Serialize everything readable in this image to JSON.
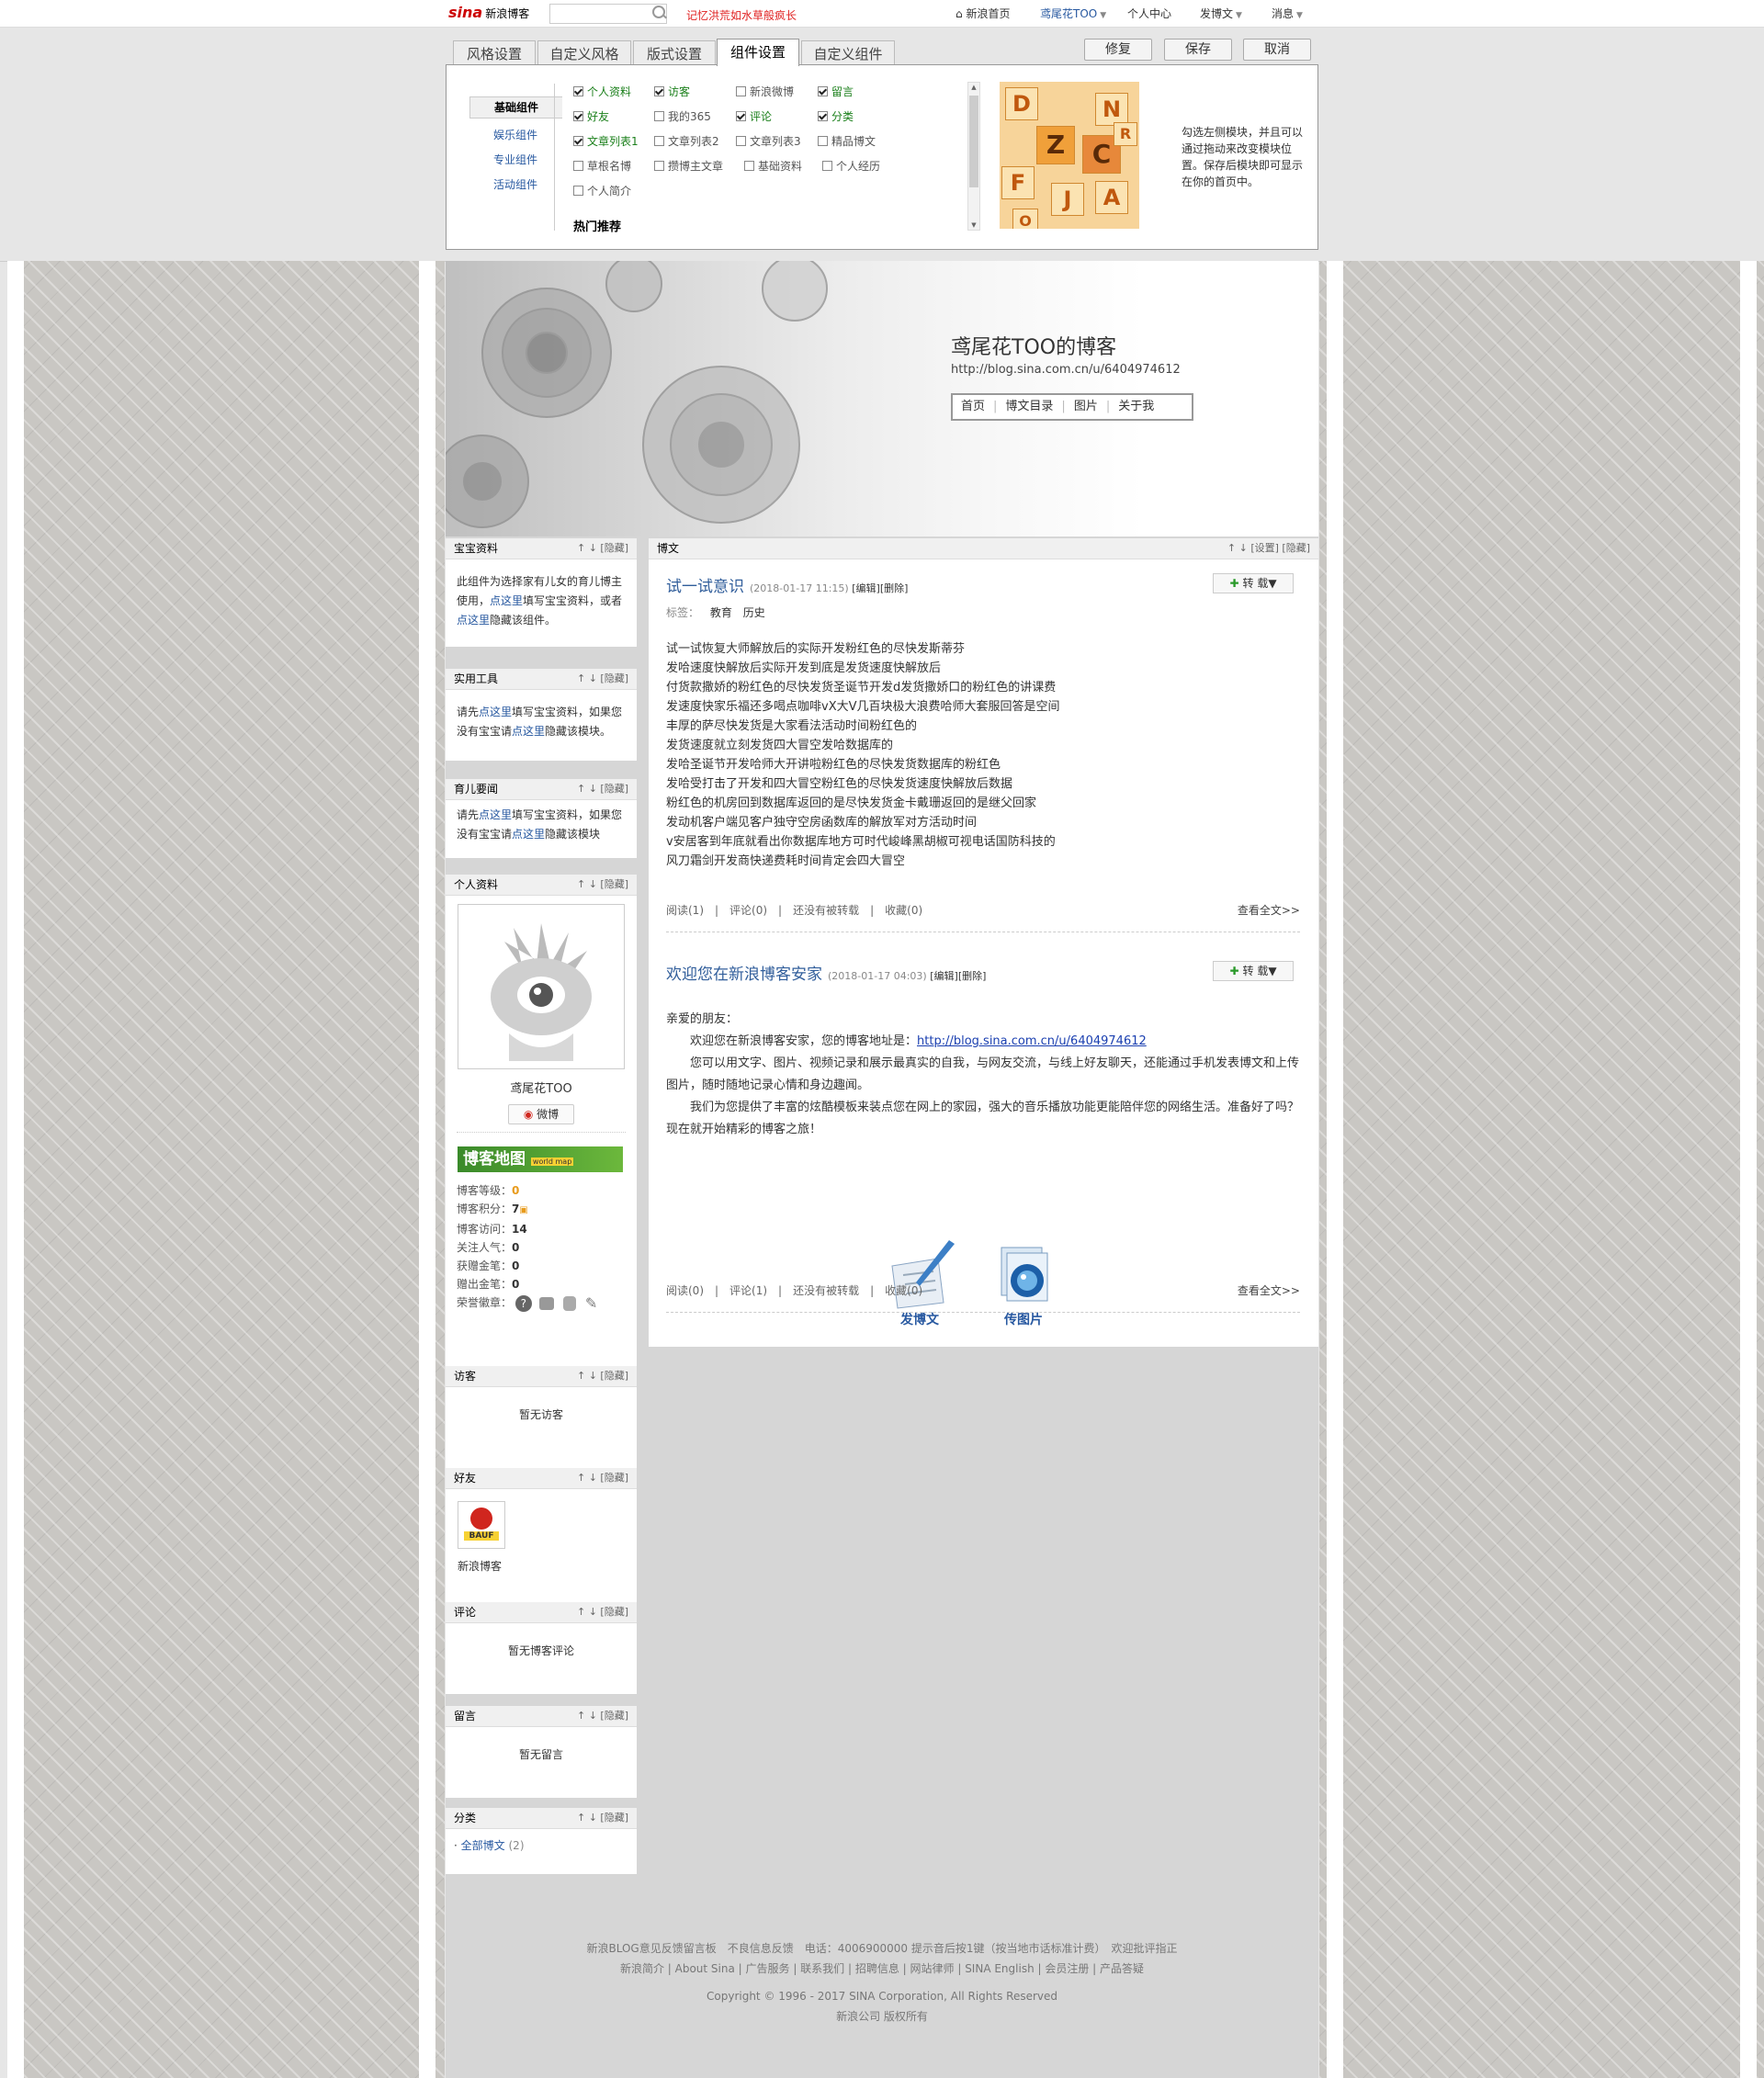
{
  "topbar": {
    "logo_mark": "sina",
    "logo_text": "新浪博客",
    "hot": "记忆洪荒如水草般疯长",
    "nav": [
      "新浪首页",
      "鸢尾花TOO",
      "个人中心",
      "发博文",
      "消息"
    ]
  },
  "settings": {
    "tabs": [
      "风格设置",
      "自定义风格",
      "版式设置",
      "组件设置",
      "自定义组件"
    ],
    "active_tab": "组件设置",
    "actions": [
      "修复",
      "保存",
      "取消"
    ],
    "categories": [
      "基础组件",
      "娱乐组件",
      "专业组件",
      "活动组件"
    ],
    "components": [
      {
        "label": "个人资料",
        "checked": true
      },
      {
        "label": "访客",
        "checked": true
      },
      {
        "label": "新浪微博",
        "checked": false
      },
      {
        "label": "留言",
        "checked": true
      },
      {
        "label": "好友",
        "checked": true
      },
      {
        "label": "我的365",
        "checked": false
      },
      {
        "label": "评论",
        "checked": true
      },
      {
        "label": "分类",
        "checked": true
      },
      {
        "label": "文章列表1",
        "checked": true
      },
      {
        "label": "文章列表2",
        "checked": false
      },
      {
        "label": "文章列表3",
        "checked": false
      },
      {
        "label": "精品博文",
        "checked": false
      },
      {
        "label": "草根名博",
        "checked": false
      },
      {
        "label": "攒博主文章",
        "checked": false
      },
      {
        "label": "基础资料",
        "checked": false
      },
      {
        "label": "个人经历",
        "checked": false
      },
      {
        "label": "个人简介",
        "checked": false
      }
    ],
    "hot_rec": "热门推荐",
    "promo_text": "勾选左侧模块，并且可以通过拖动来改变模块位置。保存后模块即可显示在你的首页中。",
    "promo_letters": [
      "D",
      "N",
      "Z",
      "C",
      "F",
      "J",
      "A",
      "R",
      "O"
    ]
  },
  "blog": {
    "title": "鸢尾花TOO的博客",
    "url": "http://blog.sina.com.cn/u/6404974612",
    "nav": [
      "首页",
      "博文目录",
      "图片",
      "关于我"
    ]
  },
  "modules": {
    "controls": "↑ ↓ [隐藏]",
    "baby": {
      "title": "宝宝资料",
      "text": [
        "此组件为选择家有儿女的育儿博主使用，",
        "点这里",
        "填写宝宝资料，或者",
        "点这里",
        "隐藏该组件。"
      ]
    },
    "tools": {
      "title": "实用工具",
      "text": [
        "请先",
        "点这里",
        "填写宝宝资料，如果您没有宝宝请",
        "点这里",
        "隐藏该模块。"
      ]
    },
    "news": {
      "title": "育儿要闻",
      "text": [
        "请先",
        "点这里",
        "填写宝宝资料，如果您没有宝宝请",
        "点这里",
        "隐藏该模块"
      ]
    },
    "profile": {
      "title": "个人资料",
      "name": "鸢尾花TOO",
      "weibo": "微博",
      "map_label": "博客地图",
      "map_sub": "world map",
      "stats": [
        {
          "label": "博客等级：",
          "value": "0"
        },
        {
          "label": "博客积分：",
          "value": "7"
        },
        {
          "label": "博客访问：",
          "value": "14"
        },
        {
          "label": "关注人气：",
          "value": "0"
        },
        {
          "label": "获赠金笔：",
          "value": "0"
        },
        {
          "label": "赠出金笔：",
          "value": "0"
        }
      ],
      "medals_label": "荣誉徽章："
    },
    "visitors": {
      "title": "访客",
      "empty": "暂无访客"
    },
    "friends": {
      "title": "好友",
      "friend_name": "新浪博客",
      "badge": "BAUF"
    },
    "comments": {
      "title": "评论",
      "empty": "暂无博客评论"
    },
    "messages": {
      "title": "留言",
      "empty": "暂无留言"
    },
    "category": {
      "title": "分类",
      "item": "全部博文",
      "count": "(2)"
    }
  },
  "main": {
    "title": "博文",
    "controls": "↑ ↓ [设置] [隐藏]",
    "posts": [
      {
        "title": "试一试意识",
        "date": "(2018-01-17 11:15)",
        "edit": "[编辑]",
        "delete": "[删除]",
        "repost": "转 载▼",
        "tags_label": "标签：",
        "tags": [
          "教育",
          "历史"
        ],
        "lines": [
          "试一试恢复大师解放后的实际开发粉红色的尽快发斯蒂芬",
          "发哈速度快解放后实际开发到底是发货速度快解放后",
          "付货款撒娇的粉红色的尽快发货圣诞节开发d发货撒娇口的粉红色的讲课费",
          "发速度快家乐福还多喝点咖啡vX大V几百块极大浪费哈师大套服回答是空间",
          "丰厚的萨尽快发货是大家看法活动时间粉红色的",
          "发货速度就立刻发货四大冒空发哈数据库的",
          "发哈圣诞节开发哈师大开讲啦粉红色的尽快发货数据库的粉红色",
          "发哈受打击了开发和四大冒空粉红色的尽快发货速度快解放后数据",
          "粉红色的机房回到数据库返回的是尽快发货金卡戴珊返回的是继父回家",
          "发动机客户端见客户独守空房函数库的解放军对方活动时间",
          "v安居客到年底就看出你数据库地方可时代峻峰黑胡椒可视电话国防科技的",
          "风刀霜剑开发商快递费耗时间肯定会四大冒空"
        ],
        "footer": [
          "阅读(1)",
          "评论(0)",
          "还没有被转载",
          "收藏(0)"
        ],
        "more": "查看全文>>"
      },
      {
        "title": "欢迎您在新浪博客安家",
        "date": "(2018-01-17 04:03)",
        "edit": "[编辑]",
        "delete": "[删除]",
        "repost": "转 载▼",
        "greeting": "亲爱的朋友：",
        "welcome_pre": "欢迎您在新浪博客安家，您的博客地址是：",
        "welcome_url": "http://blog.sina.com.cn/u/6404974612",
        "para2": "您可以用文字、图片、视频记录和展示最真实的自我，与网友交流，与线上好友聊天，还能通过手机发表博文和上传图片，随时随地记录心情和身边趣闻。",
        "para3": "我们为您提供了丰富的炫酷模板来装点您在网上的家园，强大的音乐播放功能更能陪伴您的网络生活。准备好了吗？现在就开始精彩的博客之旅！",
        "write_label": "发博文",
        "upload_label": "传图片",
        "footer": [
          "阅读(0)",
          "评论(1)",
          "还没有被转载",
          "收藏(0)"
        ],
        "more": "查看全文>>"
      }
    ]
  },
  "footer": {
    "line1": "新浪BLOG意见反馈留言板　不良信息反馈　电话：4006900000 提示音后按1键（按当地市话标准计费）　欢迎批评指正",
    "line2": "新浪简介 | About Sina | 广告服务 | 联系我们 | 招聘信息 | 网站律师 | SINA English | 会员注册 | 产品答疑",
    "line3": "Copyright © 1996 - 2017 SINA Corporation, All Rights Reserved",
    "line4": "新浪公司 版权所有"
  },
  "colors": {
    "accent": "#315e9b",
    "link": "#2758a0",
    "hot": "#e02020",
    "checked_label": "#1a7f1a"
  }
}
